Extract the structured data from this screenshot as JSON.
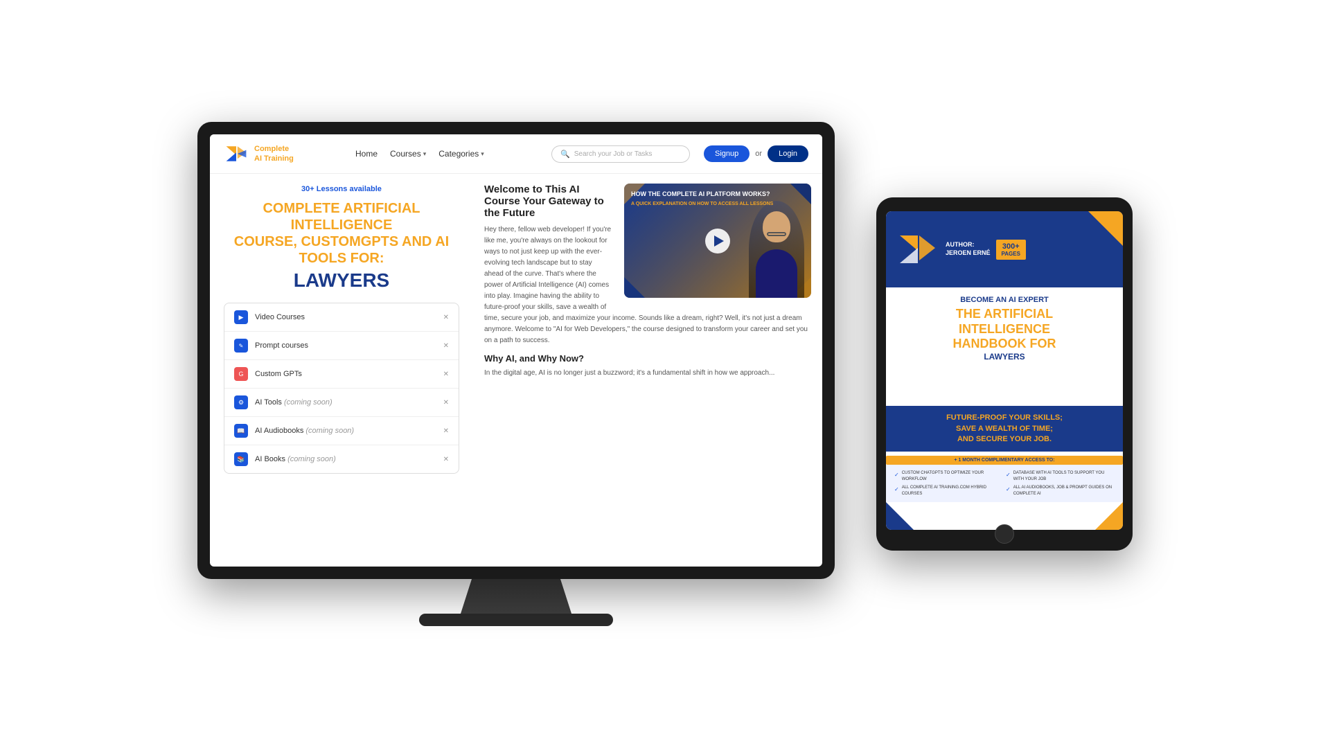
{
  "scene": {
    "bg_color": "#f0f0f0"
  },
  "monitor": {
    "screen": {
      "nav": {
        "logo_line1": "Complete",
        "logo_line2": "AI Training",
        "home_link": "Home",
        "courses_link": "Courses",
        "categories_link": "Categories",
        "search_placeholder": "Search your Job or Tasks",
        "signup_label": "Signup",
        "or_label": "or",
        "login_label": "Login"
      },
      "hero": {
        "lessons_badge": "30+ Lessons available",
        "title_line1": "COMPLETE ARTIFICIAL INTELLIGENCE",
        "title_line2": "COURSE, CUSTOMGPTS AND AI TOOLS FOR:",
        "title_highlight": "LAWYERS"
      },
      "sidebar": {
        "items": [
          {
            "label": "Video Courses",
            "icon": "video",
            "coming_soon": false
          },
          {
            "label": "Prompt courses",
            "icon": "prompt",
            "coming_soon": false
          },
          {
            "label": "Custom GPTs",
            "icon": "gpt",
            "coming_soon": false
          },
          {
            "label": "AI Tools",
            "icon": "tools",
            "coming_soon": true,
            "suffix": "(coming soon)"
          },
          {
            "label": "AI Audiobooks",
            "icon": "audiobook",
            "coming_soon": true,
            "suffix": "(coming soon)"
          },
          {
            "label": "AI Books",
            "icon": "book",
            "coming_soon": true,
            "suffix": "(coming soon)"
          }
        ]
      },
      "video": {
        "title": "HOW THE COMPLETE AI PLATFORM WORKS?",
        "subtitle": "A QUICK EXPLANATION ON HOW TO ACCESS ALL LESSONS"
      },
      "content": {
        "heading1": "Welcome to This AI Course Your Gateway to the Future",
        "para1": "Hey there, fellow web developer! If you're like me, you're always on the lookout for ways to not just keep up with the ever-evolving tech landscape but to stay ahead of the curve. That's where the power of Artificial Intelligence (AI) comes into play. Imagine having the ability to future-proof your skills, save a wealth of time, secure your job, and maximize your income. Sounds like a dream, right? Well, it's not just a dream anymore. Welcome to \"AI for Web Developers,\" the course designed to transform your career and set you on a path to success.",
        "heading2": "Why AI, and Why Now?",
        "para2": "In the digital age, AI is no longer just a buzzword; it's a fundamental shift in how we approach..."
      }
    }
  },
  "tablet": {
    "book": {
      "author_label": "AUTHOR:\nJEROEN ERNÉ",
      "pages_badge": "300+\nPAGES",
      "become_label": "BECOME AN AI EXPERT",
      "main_title_line1": "THE ARTIFICIAL",
      "main_title_line2": "INTELLIGENCE",
      "main_title_line3": "HANDBOOK FOR",
      "subtitle": "LAWYERS",
      "badge_label": "+ 1 MONTH COMPLIMENTARY ACCESS TO:",
      "future_text_line1": "FUTURE-PROOF YOUR SKILLS;",
      "future_text_line2": "SAVE A WEALTH OF TIME;",
      "future_text_line3": "AND SECURE YOUR JOB.",
      "features": [
        {
          "text": "CUSTOM CHATGPTS TO OPTIMIZE YOUR WORKFLOW"
        },
        {
          "text": "DATABASE WITH AI TOOLS TO SUPPORT YOU WITH YOUR JOB"
        },
        {
          "text": "ALL COMPLETE AI TRAINING.COM HYBRID COURSES"
        },
        {
          "text": "ALL AI AUDIOBOOKS, JOB & PROMPT GUIDES ON COMPLETE AI"
        }
      ]
    }
  }
}
